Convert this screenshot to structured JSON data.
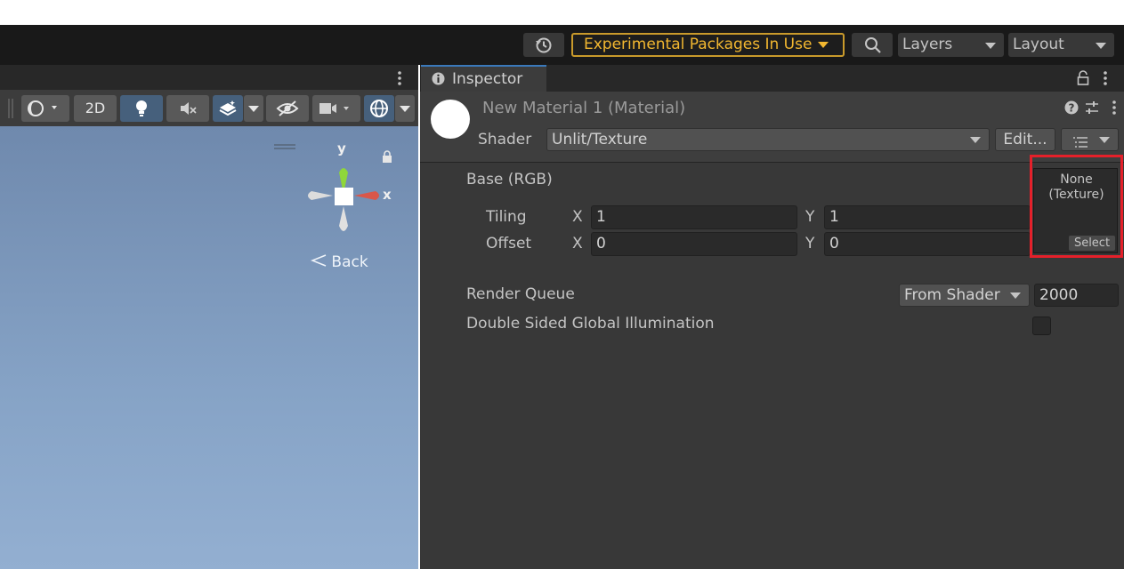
{
  "toolbar": {
    "history_icon": "history-icon",
    "experimental_label": "Experimental Packages In Use",
    "search_icon": "search-icon",
    "layers_label": "Layers",
    "layout_label": "Layout"
  },
  "scene": {
    "toolbar": {
      "mode_2d_label": "2D"
    },
    "gizmo": {
      "y_label": "y",
      "x_label": "x",
      "back_label": "Back"
    }
  },
  "inspector": {
    "tab_label": "Inspector",
    "material_title": "New Material 1 (Material)",
    "shader_label": "Shader",
    "shader_value": "Unlit/Texture",
    "edit_label": "Edit...",
    "base_label": "Base (RGB)",
    "tiling_label": "Tiling",
    "offset_label": "Offset",
    "axis_x": "X",
    "axis_y": "Y",
    "tiling_x": "1",
    "tiling_y": "1",
    "offset_x": "0",
    "offset_y": "0",
    "texture_none": "None",
    "texture_type": "(Texture)",
    "select_label": "Select",
    "render_queue_label": "Render Queue",
    "render_queue_mode": "From Shader",
    "render_queue_value": "2000",
    "double_sided_label": "Double Sided Global Illumination"
  },
  "colors": {
    "highlight": "#e5202a",
    "experimental": "#f2b730",
    "gizmo_x": "#d9574a",
    "gizmo_y": "#8fd63b"
  }
}
